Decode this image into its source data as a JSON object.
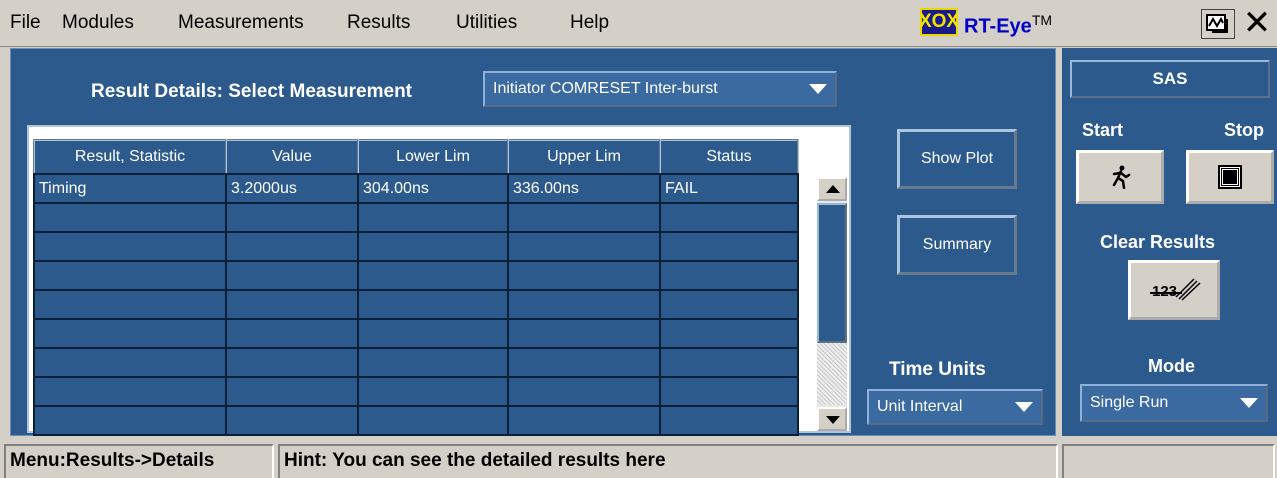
{
  "menu": {
    "items": [
      "File",
      "Modules",
      "Measurements",
      "Results",
      "Utilities",
      "Help"
    ]
  },
  "app": {
    "logo_text": "XOX",
    "title": "RT-Eye",
    "trademark": "TM"
  },
  "result_details": {
    "label": "Result Details: Select Measurement",
    "selected_measurement": "Initiator COMRESET Inter-burst"
  },
  "table": {
    "columns": [
      "Result, Statistic",
      "Value",
      "Lower Lim",
      "Upper Lim",
      "Status"
    ],
    "rows": [
      [
        "Timing",
        "3.2000us",
        "304.00ns",
        "336.00ns",
        "FAIL"
      ],
      [
        "",
        "",
        "",
        "",
        ""
      ],
      [
        "",
        "",
        "",
        "",
        ""
      ],
      [
        "",
        "",
        "",
        "",
        ""
      ],
      [
        "",
        "",
        "",
        "",
        ""
      ],
      [
        "",
        "",
        "",
        "",
        ""
      ],
      [
        "",
        "",
        "",
        "",
        ""
      ],
      [
        "",
        "",
        "",
        "",
        ""
      ],
      [
        "",
        "",
        "",
        "",
        ""
      ]
    ]
  },
  "actions": {
    "show_plot": "Show Plot",
    "summary": "Summary"
  },
  "time_units": {
    "label": "Time Units",
    "value": "Unit Interval"
  },
  "side_panel": {
    "header": "SAS",
    "start_label": "Start",
    "stop_label": "Stop",
    "clear_results_label": "Clear Results",
    "clear_icon_text": "123",
    "mode_label": "Mode",
    "mode_value": "Single Run"
  },
  "statusbar": {
    "menu_path": "Menu:Results->Details",
    "hint": "Hint: You can see the detailed results here"
  }
}
